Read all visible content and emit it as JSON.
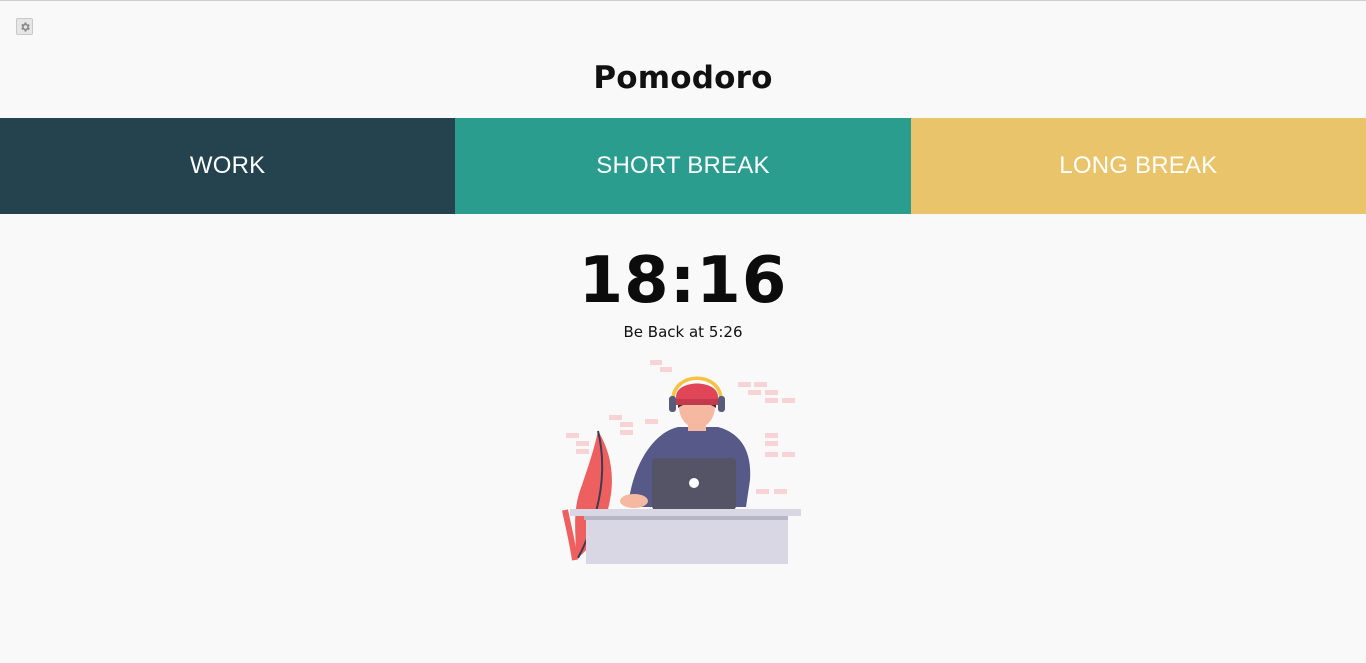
{
  "app": {
    "title": "Pomodoro"
  },
  "tabs": [
    {
      "label": "WORK",
      "color": "#25434f"
    },
    {
      "label": "SHORT BREAK",
      "color": "#2a9d8f"
    },
    {
      "label": "LONG BREAK",
      "color": "#e9c46a"
    }
  ],
  "timer": {
    "display": "18:16",
    "be_back_text": "Be Back at 5:26"
  },
  "icons": {
    "settings": "gear-icon"
  },
  "illustration": "person-with-laptop-illustration"
}
